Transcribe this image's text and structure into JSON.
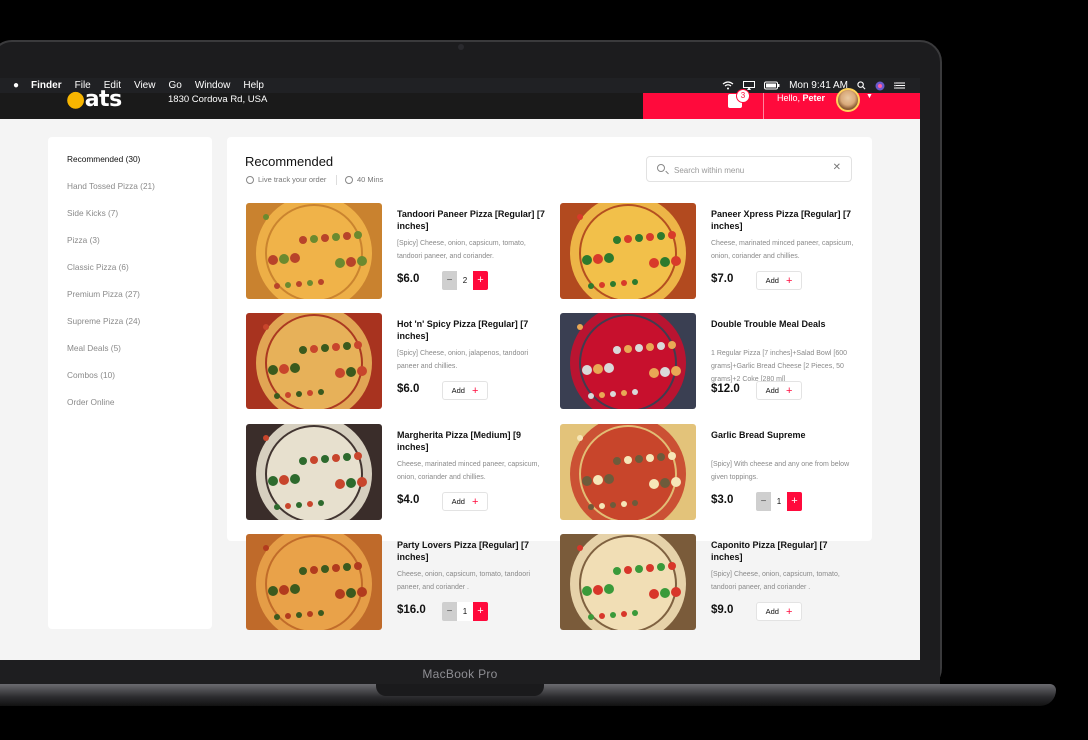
{
  "device": {
    "label": "MacBook Pro"
  },
  "menubar": {
    "apple": "",
    "items": [
      "Finder",
      "File",
      "Edit",
      "View",
      "Go",
      "Window",
      "Help"
    ],
    "clock": "Mon 9:41 AM"
  },
  "header": {
    "logo": "eats",
    "address": "1830 Cordova Rd, USA",
    "cart_count": "3",
    "greeting": "Hello, ",
    "user": "Peter",
    "accent_color": "#ff0a3c"
  },
  "sidebar": {
    "items": [
      "Recommended (30)",
      "Hand Tossed Pizza (21)",
      "Side Kicks (7)",
      "Pizza (3)",
      "Classic Pizza (6)",
      "Premium Pizza (27)",
      "Supreme Pizza (24)",
      "Meal Deals (5)",
      "Combos (10)",
      "Order Online"
    ]
  },
  "main": {
    "title": "Recommended",
    "track": "Live track your order",
    "time": "40 Mins",
    "search_placeholder": "Search within menu",
    "add_label": "Add",
    "items": [
      {
        "name": "Tandoori Paneer Pizza [Regular] [7 inches]",
        "desc": "[Spicy] Cheese, onion, capsicum, tomato, tandoori paneer, and coriander.",
        "price": "$6.0",
        "qty": "2"
      },
      {
        "name": "Paneer Xpress Pizza [Regular] [7 inches]",
        "desc": "Cheese, marinated minced paneer, capsicum, onion, coriander and chillies.",
        "price": "$7.0",
        "qty": null
      },
      {
        "name": "Hot 'n' Spicy Pizza [Regular] [7 inches]",
        "desc": "[Spicy] Cheese, onion, jalapenos, tandoori paneer and chillies.",
        "price": "$6.0",
        "qty": null
      },
      {
        "name": "Double Trouble Meal Deals",
        "desc": "1 Regular Pizza [7 inches]+Salad Bowl [600 grams]+Garlic Bread Cheese [2 Pieces, 50 grams]+2 Coke [280 ml]",
        "price": "$12.0",
        "qty": null
      },
      {
        "name": "Margherita Pizza [Medium] [9 inches]",
        "desc": "Cheese, marinated minced paneer, capsicum, onion, coriander and chillies.",
        "price": "$4.0",
        "qty": null
      },
      {
        "name": "Garlic Bread Supreme",
        "desc": "[Spicy] With cheese and any one from below given toppings.",
        "price": "$3.0",
        "qty": "1"
      },
      {
        "name": "Party Lovers Pizza [Regular] [7 inches]",
        "desc": "Cheese, onion, capsicum, tomato, tandoori paneer, and coriander .",
        "price": "$16.0",
        "qty": "1"
      },
      {
        "name": "Caponito Pizza [Regular] [7 inches]",
        "desc": "[Spicy] Cheese, onion, capsicum, tomato, tandoori paneer, and coriander .",
        "price": "$9.0",
        "qty": null
      }
    ]
  }
}
